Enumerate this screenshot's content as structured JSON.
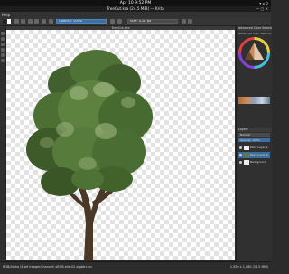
{
  "system": {
    "clock": "Apr 10  9:52 PM",
    "indicators": "▾ ◂ ⏻"
  },
  "window": {
    "title": "TreeCut.kra (24.5 MiB) — Krita",
    "buttons": "— ▢ ✕"
  },
  "menu": {
    "first_item": "Help"
  },
  "toolbar": {
    "opacity_label": "Opacity: 100%",
    "size_label": "Size: 4.21 px"
  },
  "document": {
    "tab_title": "TreeCut.kra"
  },
  "color_panel": {
    "title": "Advanced Color Selector",
    "subtitle": "Advanced Color Selector"
  },
  "layers_panel": {
    "title": "Layers",
    "blend_mode": "Normal",
    "opacity": "Opacity: 100%",
    "rows": [
      {
        "name": "Paint Layer 2",
        "selected": false
      },
      {
        "name": "Paint Layer 3",
        "selected": true
      },
      {
        "name": "Background",
        "selected": false
      }
    ]
  },
  "status": {
    "left": "RGB/Alpha (8-bit integer/channel) sRGB-elle-V2-srgbtrc.icc",
    "right": "1,920 x 1,080 (24.5 MiB)"
  },
  "colors": {
    "accent": "#3e6d9c",
    "panel": "#303030"
  }
}
